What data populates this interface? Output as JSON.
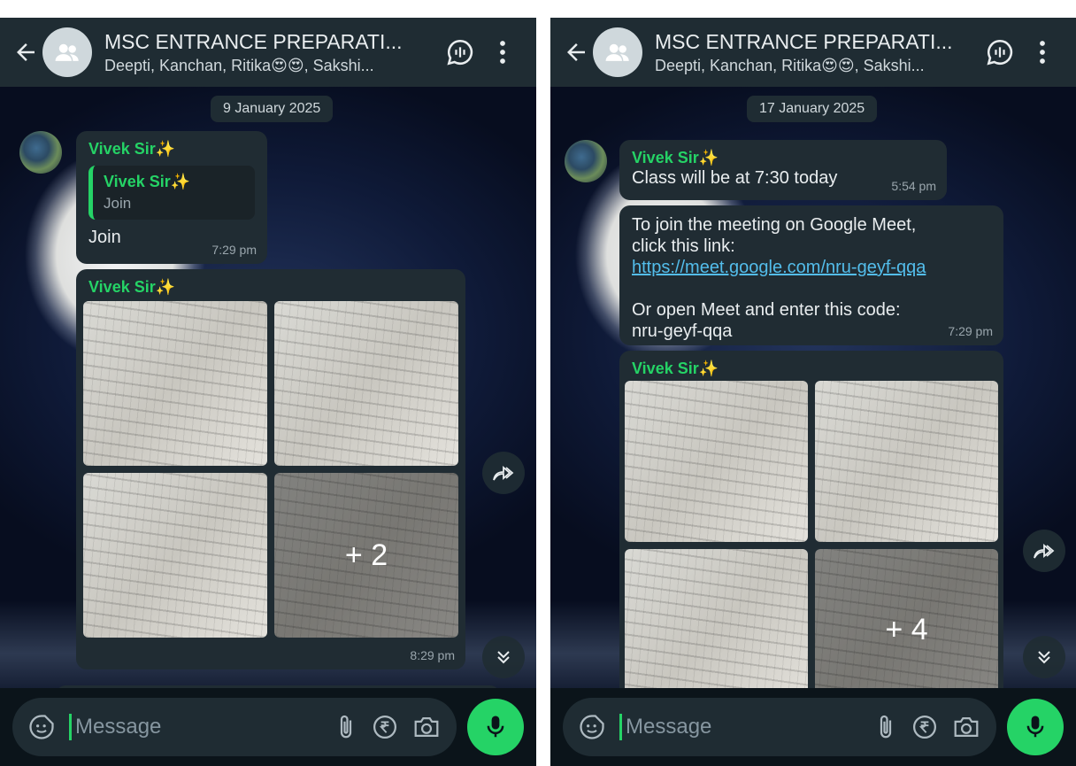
{
  "left": {
    "chat_title": "MSC ENTRANCE PREPARATI...",
    "chat_subtitle": "Deepti, Kanchan, Ritika😍😍, Sakshi...",
    "date_chip": "9 January 2025",
    "msg1": {
      "sender": "Vivek Sir✨",
      "quote_sender": "Vivek Sir✨",
      "quote_text": "Join",
      "text": "Join",
      "time": "7:29 pm"
    },
    "album": {
      "sender": "Vivek Sir✨",
      "more_count": "+ 2",
      "time": "8:29 pm"
    },
    "composer_placeholder": "Message"
  },
  "right": {
    "chat_title": "MSC ENTRANCE PREPARATI...",
    "chat_subtitle": "Deepti, Kanchan, Ritika😍😍, Sakshi...",
    "date_chip": "17 January 2025",
    "msg1": {
      "sender": "Vivek Sir✨",
      "text": "Class will be at 7:30 today",
      "time": "5:54 pm"
    },
    "msg2": {
      "line1": "To join the meeting on Google Meet,",
      "line2": "click this link:",
      "link": "https://meet.google.com/nru-geyf-qqa",
      "line3": "Or open Meet and enter this code:",
      "line4": "nru-geyf-qqa",
      "time": "7:29 pm"
    },
    "album": {
      "sender": "Vivek Sir✨",
      "more_count": "+ 4"
    },
    "composer_placeholder": "Message"
  },
  "colors": {
    "accent_green": "#25d366",
    "bubble": "#202c33",
    "header": "#1f2c33",
    "link": "#53bdeb"
  },
  "icons": [
    "back-arrow-icon",
    "group-avatar-icon",
    "voice-call-icon",
    "more-vert-icon",
    "forward-icon",
    "scroll-down-icon",
    "sticker-icon",
    "attach-icon",
    "rupee-payment-icon",
    "camera-icon",
    "mic-icon"
  ]
}
